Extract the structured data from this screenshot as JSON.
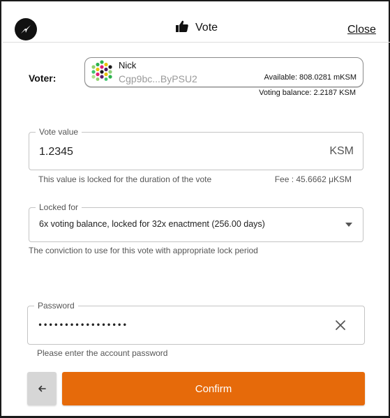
{
  "header": {
    "title": "Vote",
    "close_label": "Close",
    "logo_icon": "polkadot-logo-icon",
    "title_icon": "thumbs-up-icon"
  },
  "voter": {
    "label": "Voter:",
    "account_name": "Nick",
    "account_address": "Cgp9bc...ByPSU2",
    "available": "Available: 808.0281 mKSM",
    "voting_balance": "Voting balance: 2.2187 KSM"
  },
  "vote_value": {
    "legend": "Vote value",
    "value": "1.2345",
    "unit": "KSM",
    "helper": "This value is locked for the duration of the vote",
    "fee": "Fee : 45.6662 μKSM"
  },
  "locked_for": {
    "legend": "Locked for",
    "selected": "6x voting balance, locked for 32x enactment (256.00 days)",
    "helper": "The conviction to use for this vote with appropriate lock period"
  },
  "password": {
    "legend": "Password",
    "value": "•••••••••••••••••",
    "helper": "Please enter the account password"
  },
  "actions": {
    "back_icon": "arrow-left-icon",
    "confirm_label": "Confirm"
  },
  "colors": {
    "accent": "#e66a0a",
    "back_button": "#d6d6d6"
  }
}
